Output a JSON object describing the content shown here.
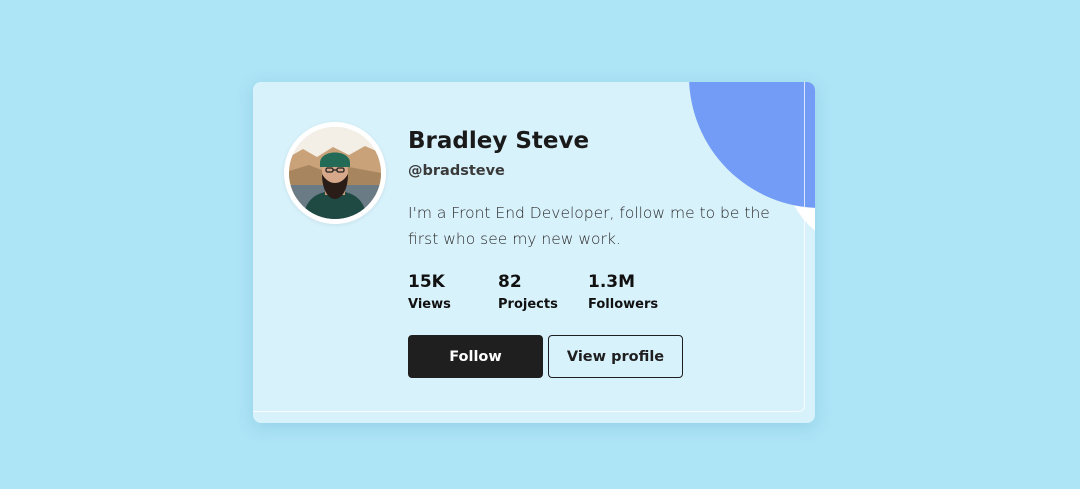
{
  "profile": {
    "name": "Bradley Steve",
    "handle": "@bradsteve",
    "bio": "I'm a Front End Developer, follow me to be the first who see my new work."
  },
  "stats": [
    {
      "value": "15K",
      "label": "Views"
    },
    {
      "value": "82",
      "label": "Projects"
    },
    {
      "value": "1.3M",
      "label": "Followers"
    }
  ],
  "actions": {
    "follow_label": "Follow",
    "view_profile_label": "View profile"
  },
  "colors": {
    "page_background": "#ade4f6",
    "card_background": "#d8f2fc",
    "accent_circle": "#739cf6",
    "button_dark": "#1f1f1f"
  }
}
